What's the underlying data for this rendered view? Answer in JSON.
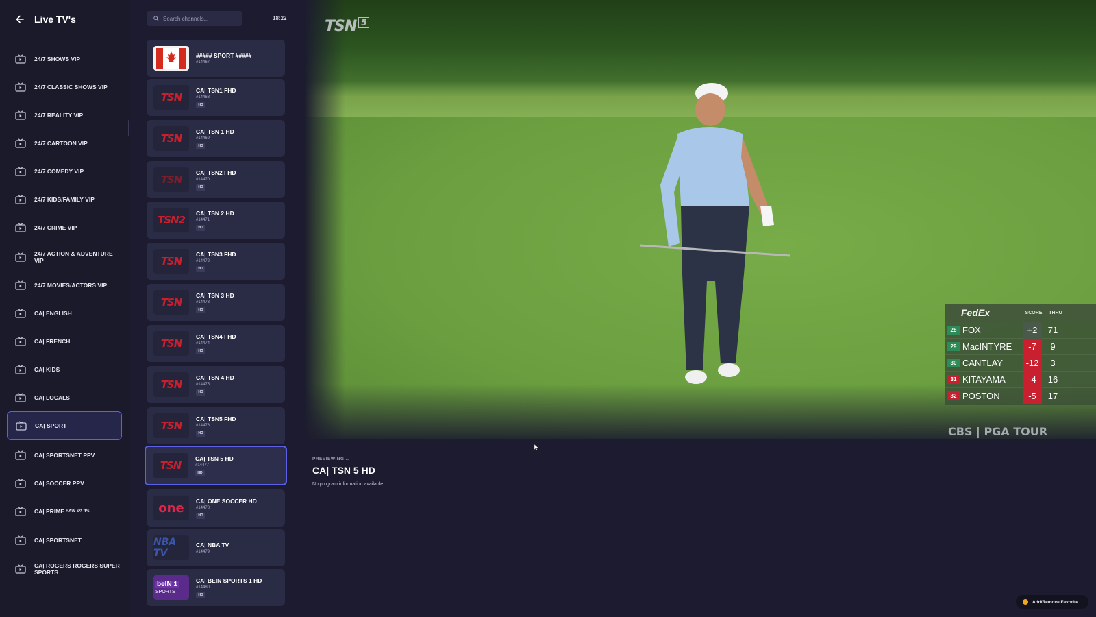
{
  "header": {
    "title": "Live TV's"
  },
  "search": {
    "placeholder": "Search channels..."
  },
  "clock": "18:22",
  "colors": {
    "accent": "#5b60e6",
    "background": "#1c1b2f",
    "card": "#2a2b45",
    "tsn_red": "#c8202f",
    "favorite": "#f5a623"
  },
  "sidebar": {
    "items": [
      {
        "label": "24/7 SHOWS VIP"
      },
      {
        "label": "24/7 CLASSIC SHOWS VIP"
      },
      {
        "label": "24/7 REALITY VIP"
      },
      {
        "label": "24/7 CARTOON VIP"
      },
      {
        "label": "24/7 COMEDY VIP"
      },
      {
        "label": "24/7 KIDS/FAMILY VIP"
      },
      {
        "label": "24/7 CRIME VIP"
      },
      {
        "label": "24/7 ACTION & ADVENTURE VIP"
      },
      {
        "label": "24/7 MOVIES/ACTORS VIP"
      },
      {
        "label": "CA| ENGLISH"
      },
      {
        "label": "CA| FRENCH"
      },
      {
        "label": "CA| KIDS"
      },
      {
        "label": "CA| LOCALS"
      },
      {
        "label": "CA| SPORT",
        "active": true
      },
      {
        "label": "CA| SPORTSNET PPV"
      },
      {
        "label": "CA| SOCCER PPV"
      },
      {
        "label": "CA| PRIME ᴿᴬᵂ ⁶⁰ ᶠᴾˢ"
      },
      {
        "label": "CA| SPORTSNET"
      },
      {
        "label": "CA| ROGERS ROGERS SUPER SPORTS"
      }
    ]
  },
  "channels": [
    {
      "name": "##### SPORT #####",
      "number": "#14467",
      "logo": "canada-flag-icon",
      "logo_text": "",
      "hd": ""
    },
    {
      "name": "CA| TSN1 FHD",
      "number": "#14468",
      "logo": "tsn-logo",
      "logo_text": "TSN",
      "hd": "HD"
    },
    {
      "name": "CA| TSN 1 HD",
      "number": "#14469",
      "logo": "tsn-logo",
      "logo_text": "TSN",
      "hd": "HD"
    },
    {
      "name": "CA| TSN2 FHD",
      "number": "#14470",
      "logo": "tsn-logo",
      "logo_text": "TSN",
      "hd": "HD"
    },
    {
      "name": "CA| TSN 2 HD",
      "number": "#14471",
      "logo": "tsn-logo",
      "logo_text": "TSN2",
      "hd": "HD"
    },
    {
      "name": "CA| TSN3 FHD",
      "number": "#14472",
      "logo": "tsn-logo",
      "logo_text": "TSN",
      "hd": "HD"
    },
    {
      "name": "CA| TSN 3 HD",
      "number": "#14473",
      "logo": "tsn-logo",
      "logo_text": "TSN",
      "hd": "HD"
    },
    {
      "name": "CA| TSN4 FHD",
      "number": "#14474",
      "logo": "tsn-logo",
      "logo_text": "TSN",
      "hd": "HD"
    },
    {
      "name": "CA| TSN 4 HD",
      "number": "#14475",
      "logo": "tsn-logo",
      "logo_text": "TSN",
      "hd": "HD"
    },
    {
      "name": "CA| TSN5 FHD",
      "number": "#14476",
      "logo": "tsn-logo",
      "logo_text": "TSN",
      "hd": "HD"
    },
    {
      "name": "CA| TSN 5 HD",
      "number": "#14477",
      "logo": "tsn-logo",
      "logo_text": "TSN",
      "hd": "HD",
      "selected": true
    },
    {
      "name": "CA| ONE SOCCER HD",
      "number": "#14478",
      "logo": "one-soccer-logo",
      "logo_text": "one",
      "hd": "HD"
    },
    {
      "name": "CA| NBA TV",
      "number": "#14479",
      "logo": "nba-tv-logo",
      "logo_text": "NBA TV",
      "hd": ""
    },
    {
      "name": "CA| BEIN SPORTS 1 HD",
      "number": "#14480",
      "logo": "bein-sports-logo",
      "logo_text": "beIN 1",
      "hd": "HD"
    }
  ],
  "video": {
    "channel_bug": "TSN",
    "channel_bug_num": "5",
    "network_bug": "CBS | PGA TOUR",
    "leaderboard": {
      "brand": "FedEx",
      "col_score": "SCORE",
      "col_thru": "THRU",
      "rows": [
        {
          "pos": "28",
          "name": "FOX",
          "score": "+2",
          "thru": "71",
          "pos_color": "#2e8b57",
          "score_color": "#4a5a4a"
        },
        {
          "pos": "29",
          "name": "MacINTYRE",
          "score": "-7",
          "thru": "9",
          "pos_color": "#2e8b57",
          "score_color": "#c8202f"
        },
        {
          "pos": "30",
          "name": "CANTLAY",
          "score": "-12",
          "thru": "3",
          "pos_color": "#2e8b57",
          "score_color": "#c8202f"
        },
        {
          "pos": "31",
          "name": "KITAYAMA",
          "score": "-4",
          "thru": "16",
          "pos_color": "#c8202f",
          "score_color": "#c8202f"
        },
        {
          "pos": "32",
          "name": "POSTON",
          "score": "-5",
          "thru": "17",
          "pos_color": "#c8202f",
          "score_color": "#c8202f"
        }
      ]
    }
  },
  "preview": {
    "label": "PREVIEWING...",
    "title": "CA| TSN 5 HD",
    "description": "No program information available"
  },
  "favorite_button": {
    "label": "Add/Remove Favorite"
  }
}
